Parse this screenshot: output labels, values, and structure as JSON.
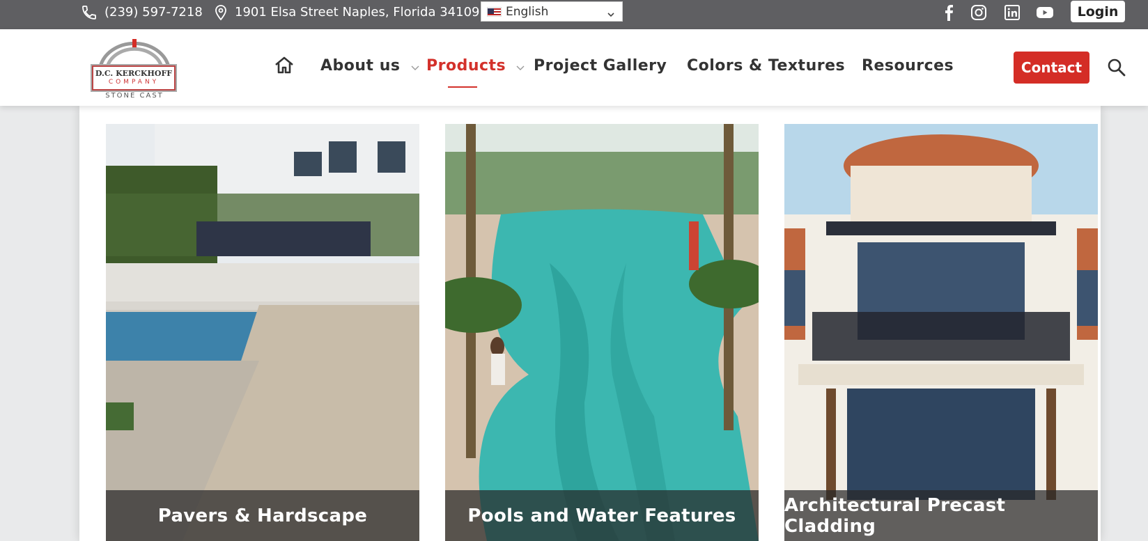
{
  "topbar": {
    "phone": "(239) 597-7218",
    "address": "1901 Elsa Street Naples, Florida 34109",
    "language": "English",
    "social_icons": [
      "facebook-icon",
      "instagram-icon",
      "linkedin-icon",
      "youtube-icon"
    ],
    "login_label": "Login"
  },
  "logo": {
    "line1": "D.C. KERCKHOFF",
    "line2": "COMPANY",
    "line3": "STONE CAST"
  },
  "nav": {
    "items": [
      {
        "label": "About us",
        "has_dropdown": true
      },
      {
        "label": "Products",
        "has_dropdown": true,
        "active": true
      },
      {
        "label": "Project Gallery"
      },
      {
        "label": "Colors & Textures"
      },
      {
        "label": "Resources"
      }
    ],
    "contact_label": "Contact"
  },
  "cards": [
    {
      "title": "Pavers & Hardscape"
    },
    {
      "title": "Pools and Water Features"
    },
    {
      "title": "Architectural Precast Cladding"
    }
  ],
  "colors": {
    "accent": "#d42d26",
    "topbar": "#5f5f62"
  }
}
